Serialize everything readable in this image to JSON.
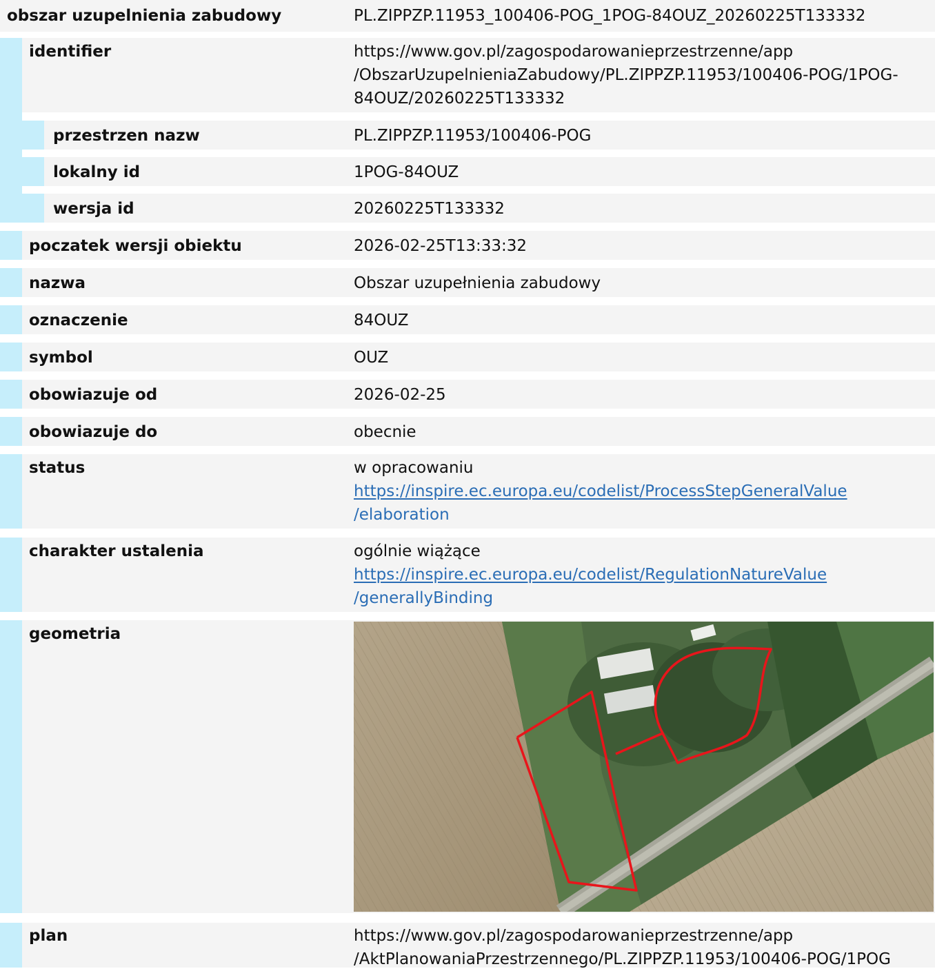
{
  "header": {
    "label": "obszar uzupelnienia zabudowy",
    "value": "PL.ZIPPZP.11953_100406-POG_1POG-84OUZ_20260225T133332"
  },
  "identifier": {
    "label": "identifier",
    "value_lines": [
      "https://www.gov.pl/zagospodarowanieprzestrzenne/app",
      "/ObszarUzupelnieniaZabudowy/PL.ZIPPZP.11953/100406-POG/1POG-",
      "84OUZ/20260225T133332"
    ],
    "przestrzen_nazw": {
      "label": "przestrzen nazw",
      "value": "PL.ZIPPZP.11953/100406-POG"
    },
    "lokalny_id": {
      "label": "lokalny id",
      "value": "1POG-84OUZ"
    },
    "wersja_id": {
      "label": "wersja id",
      "value": "20260225T133332"
    }
  },
  "fields": [
    {
      "label": "poczatek wersji obiektu",
      "value": "2026-02-25T13:33:32"
    },
    {
      "label": "nazwa",
      "value": "Obszar uzupełnienia zabudowy"
    },
    {
      "label": "oznaczenie",
      "value": "84OUZ"
    },
    {
      "label": "symbol",
      "value": "OUZ"
    },
    {
      "label": "obowiazuje od",
      "value": "2026-02-25"
    },
    {
      "label": "obowiazuje do",
      "value": "obecnie"
    }
  ],
  "status": {
    "label": "status",
    "value": "w opracowaniu",
    "link_lines": [
      "https://inspire.ec.europa.eu/codelist/ProcessStepGeneralValue",
      "/elaboration"
    ]
  },
  "charakter": {
    "label": "charakter ustalenia",
    "value": "ogólnie wiążące",
    "link_lines": [
      "https://inspire.ec.europa.eu/codelist/RegulationNatureValue",
      "/generallyBinding"
    ]
  },
  "geometria": {
    "label": "geometria"
  },
  "plan": {
    "label": "plan",
    "value_lines": [
      "https://www.gov.pl/zagospodarowanieprzestrzenne/app",
      "/AktPlanowaniaPrzestrzennego/PL.ZIPPZP.11953/100406-POG/1POG"
    ]
  },
  "colors": {
    "accent_bar": "#c6eefb",
    "row_bg": "#f4f4f4",
    "link": "#2a6db5",
    "outline": "#e8151b"
  }
}
